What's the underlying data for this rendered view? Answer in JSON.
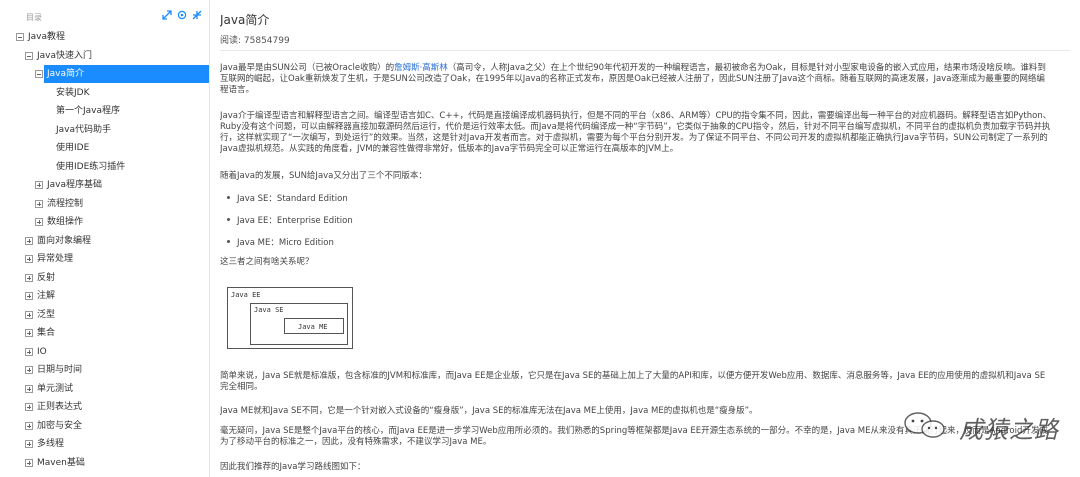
{
  "sidebar": {
    "title": "目录",
    "tree": [
      {
        "label": "Java教程",
        "toggle": "minus"
      },
      {
        "label": "Java快速入门",
        "toggle": "minus"
      },
      {
        "label": "Java简介",
        "toggle": "minus",
        "selected": true
      },
      {
        "label": "安装JDK",
        "toggle": ""
      },
      {
        "label": "第一个Java程序",
        "toggle": ""
      },
      {
        "label": "Java代码助手",
        "toggle": ""
      },
      {
        "label": "使用IDE",
        "toggle": ""
      },
      {
        "label": "使用IDE练习插件",
        "toggle": ""
      },
      {
        "label": "Java程序基础",
        "toggle": "plus"
      },
      {
        "label": "流程控制",
        "toggle": "plus"
      },
      {
        "label": "数组操作",
        "toggle": "plus"
      },
      {
        "label": "面向对象编程",
        "toggle": "plus"
      },
      {
        "label": "异常处理",
        "toggle": "plus"
      },
      {
        "label": "反射",
        "toggle": "plus"
      },
      {
        "label": "注解",
        "toggle": "plus"
      },
      {
        "label": "泛型",
        "toggle": "plus"
      },
      {
        "label": "集合",
        "toggle": "plus"
      },
      {
        "label": "IO",
        "toggle": "plus"
      },
      {
        "label": "日期与时间",
        "toggle": "plus"
      },
      {
        "label": "单元测试",
        "toggle": "plus"
      },
      {
        "label": "正则表达式",
        "toggle": "plus"
      },
      {
        "label": "加密与安全",
        "toggle": "plus"
      },
      {
        "label": "多线程",
        "toggle": "plus"
      },
      {
        "label": "Maven基础",
        "toggle": "plus"
      }
    ]
  },
  "main": {
    "title": "Java简介",
    "read_label": "阅读: 75854799",
    "p1_before": "Java最早是由SUN公司（已被Oracle收购）的",
    "p1_link": "詹姆斯·高斯林",
    "p1_after": "（高司令，人称Java之父）在上个世纪90年代初开发的一种编程语言，最初被命名为Oak，目标是针对小型家电设备的嵌入式应用，结果市场没啥反响。谁料到互联网的崛起，让Oak重新焕发了生机，于是SUN公司改造了Oak，在1995年以Java的名称正式发布，原因是Oak已经被人注册了，因此SUN注册了Java这个商标。随着互联网的高速发展，Java逐渐成为最重要的网络编程语言。",
    "p2": "Java介于编译型语言和解释型语言之间。编译型语言如C、C++，代码是直接编译成机器码执行，但是不同的平台（x86、ARM等）CPU的指令集不同，因此，需要编译出每一种平台的对应机器码。解释型语言如Python、Ruby没有这个问题，可以由解释器直接加载源码然后运行，代价是运行效率太低。而Java是将代码编译成一种“字节码”，它类似于抽象的CPU指令，然后，针对不同平台编写虚拟机，不同平台的虚拟机负责加载字节码并执行，这样就实现了“一次编写，到处运行”的效果。当然，这是针对Java开发者而言。对于虚拟机，需要为每个平台分别开发。为了保证不同平台、不同公司开发的虚拟机都能正确执行Java字节码，SUN公司制定了一系列的Java虚拟机规范。从实践的角度看，JVM的兼容性做得非常好，低版本的Java字节码完全可以正常运行在高版本的JVM上。",
    "p3": "随着Java的发展，SUN给Java又分出了三个不同版本：",
    "editions": [
      "Java SE：Standard Edition",
      "Java EE：Enterprise Edition",
      "Java ME：Micro Edition"
    ],
    "p4": "这三者之间有啥关系呢？",
    "diagram": {
      "outer": "Java EE",
      "middle": "Java SE",
      "inner": "Java ME"
    },
    "p5": "简单来说，Java SE就是标准版，包含标准的JVM和标准库，而Java EE是企业版，它只是在Java SE的基础上加上了大量的API和库，以便方便开发Web应用、数据库、消息服务等，Java EE的应用使用的虚拟机和Java SE完全相同。",
    "p6": "Java ME就和Java SE不同，它是一个针对嵌入式设备的“瘦身版”，Java SE的标准库无法在Java ME上使用，Java ME的虚拟机也是“瘦身版”。",
    "p7": "毫无疑问，Java SE是整个Java平台的核心，而Java EE是进一步学习Web应用所必须的。我们熟悉的Spring等框架都是Java EE开源生态系统的一部分。不幸的是，Java ME从来没有真正流行起来，反而是Android开发成为了移动平台的标准之一，因此，没有特殊需求，不建议学习Java ME。",
    "p8": "因此我们推荐的Java学习路线图如下：",
    "watermark": "成猿之路"
  }
}
